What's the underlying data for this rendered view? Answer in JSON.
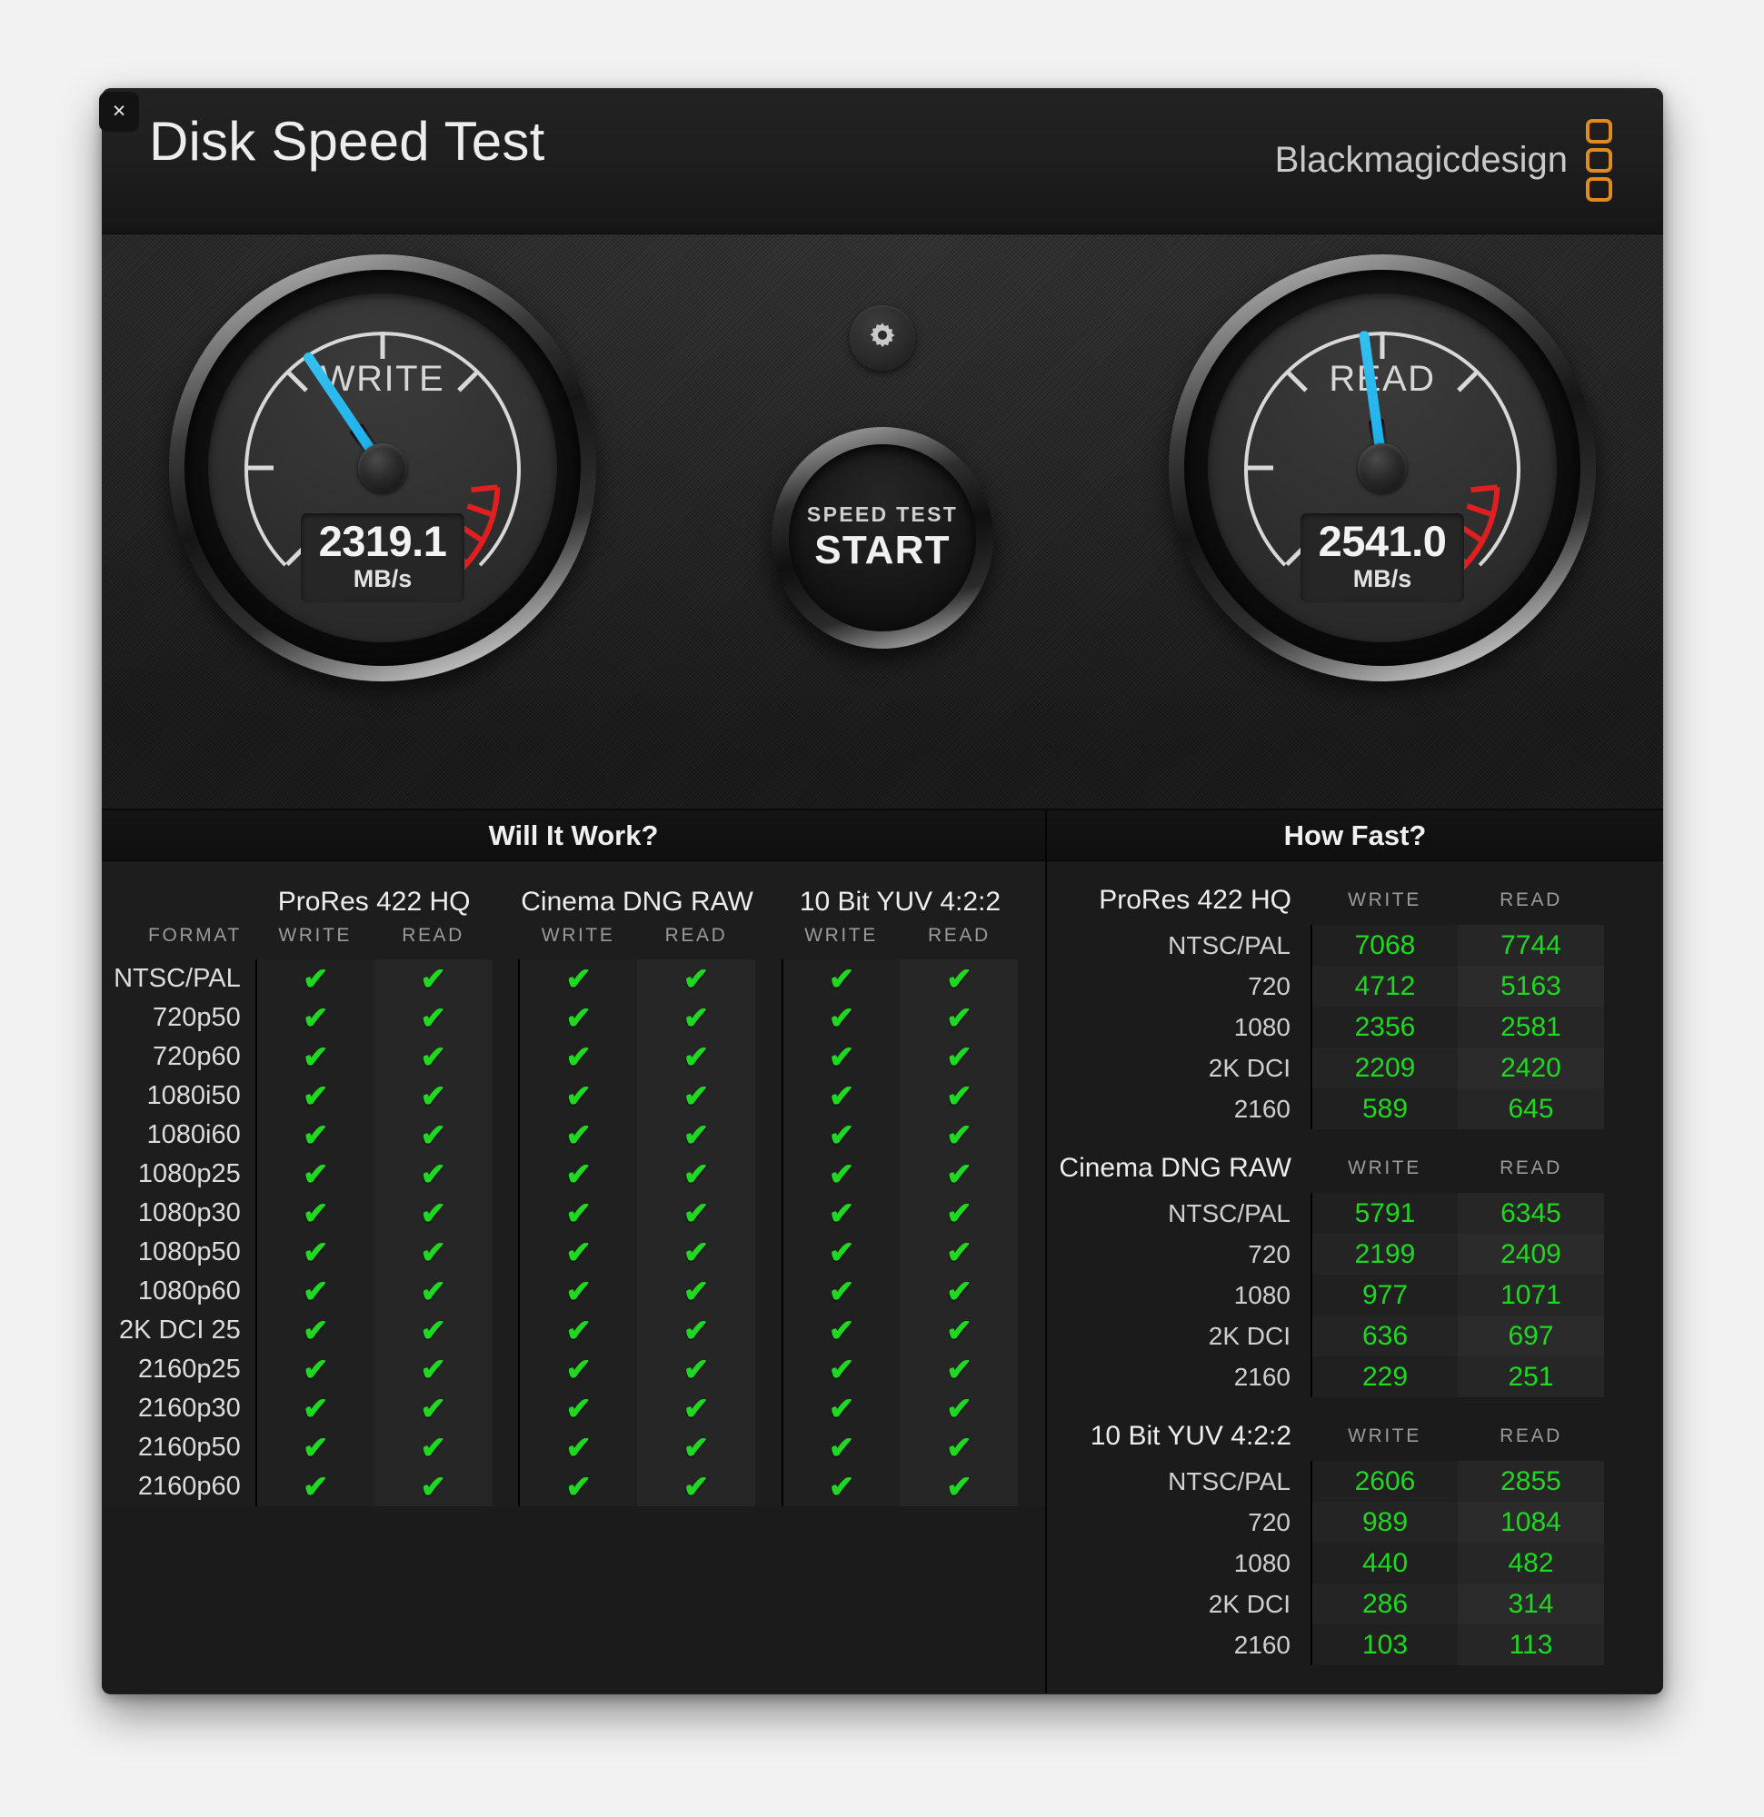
{
  "window": {
    "title": "Disk Speed Test",
    "close_label": "×",
    "brand": "Blackmagicdesign",
    "brand_color": "#e08b21"
  },
  "gauges": {
    "write": {
      "label": "WRITE",
      "value": "2319.1",
      "unit": "MB/s",
      "needle_deg": -34
    },
    "read": {
      "label": "READ",
      "value": "2541.0",
      "unit": "MB/s",
      "needle_deg": -8
    },
    "needle_color": "#22b4ec",
    "redzone_color": "#e02020"
  },
  "center": {
    "settings_icon": "gear-icon",
    "start_sub": "SPEED TEST",
    "start_main": "START"
  },
  "will_it_work": {
    "title": "Will It Work?",
    "format_header": "FORMAT",
    "groups": [
      "ProRes 422 HQ",
      "Cinema DNG RAW",
      "10 Bit YUV 4:2:2"
    ],
    "sub_headers": [
      "WRITE",
      "READ"
    ],
    "check_glyph": "✔",
    "check_color": "#1fd821",
    "rows": [
      {
        "format": "NTSC/PAL",
        "cells": [
          true,
          true,
          true,
          true,
          true,
          true
        ]
      },
      {
        "format": "720p50",
        "cells": [
          true,
          true,
          true,
          true,
          true,
          true
        ]
      },
      {
        "format": "720p60",
        "cells": [
          true,
          true,
          true,
          true,
          true,
          true
        ]
      },
      {
        "format": "1080i50",
        "cells": [
          true,
          true,
          true,
          true,
          true,
          true
        ]
      },
      {
        "format": "1080i60",
        "cells": [
          true,
          true,
          true,
          true,
          true,
          true
        ]
      },
      {
        "format": "1080p25",
        "cells": [
          true,
          true,
          true,
          true,
          true,
          true
        ]
      },
      {
        "format": "1080p30",
        "cells": [
          true,
          true,
          true,
          true,
          true,
          true
        ]
      },
      {
        "format": "1080p50",
        "cells": [
          true,
          true,
          true,
          true,
          true,
          true
        ]
      },
      {
        "format": "1080p60",
        "cells": [
          true,
          true,
          true,
          true,
          true,
          true
        ]
      },
      {
        "format": "2K DCI 25",
        "cells": [
          true,
          true,
          true,
          true,
          true,
          true
        ]
      },
      {
        "format": "2160p25",
        "cells": [
          true,
          true,
          true,
          true,
          true,
          true
        ]
      },
      {
        "format": "2160p30",
        "cells": [
          true,
          true,
          true,
          true,
          true,
          true
        ]
      },
      {
        "format": "2160p50",
        "cells": [
          true,
          true,
          true,
          true,
          true,
          true
        ]
      },
      {
        "format": "2160p60",
        "cells": [
          true,
          true,
          true,
          true,
          true,
          true
        ]
      }
    ]
  },
  "how_fast": {
    "title": "How Fast?",
    "col_write": "WRITE",
    "col_read": "READ",
    "value_color": "#1fd821",
    "sections": [
      {
        "name": "ProRes 422 HQ",
        "rows": [
          {
            "label": "NTSC/PAL",
            "write": "7068",
            "read": "7744"
          },
          {
            "label": "720",
            "write": "4712",
            "read": "5163"
          },
          {
            "label": "1080",
            "write": "2356",
            "read": "2581"
          },
          {
            "label": "2K DCI",
            "write": "2209",
            "read": "2420"
          },
          {
            "label": "2160",
            "write": "589",
            "read": "645"
          }
        ]
      },
      {
        "name": "Cinema DNG RAW",
        "rows": [
          {
            "label": "NTSC/PAL",
            "write": "5791",
            "read": "6345"
          },
          {
            "label": "720",
            "write": "2199",
            "read": "2409"
          },
          {
            "label": "1080",
            "write": "977",
            "read": "1071"
          },
          {
            "label": "2K DCI",
            "write": "636",
            "read": "697"
          },
          {
            "label": "2160",
            "write": "229",
            "read": "251"
          }
        ]
      },
      {
        "name": "10 Bit YUV 4:2:2",
        "rows": [
          {
            "label": "NTSC/PAL",
            "write": "2606",
            "read": "2855"
          },
          {
            "label": "720",
            "write": "989",
            "read": "1084"
          },
          {
            "label": "1080",
            "write": "440",
            "read": "482"
          },
          {
            "label": "2K DCI",
            "write": "286",
            "read": "314"
          },
          {
            "label": "2160",
            "write": "103",
            "read": "113"
          }
        ]
      }
    ]
  }
}
